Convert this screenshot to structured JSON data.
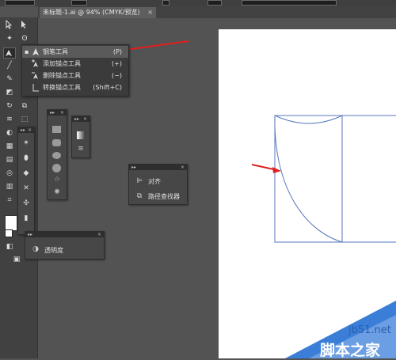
{
  "document_tab": {
    "title": "未标题-1.ai @ 94% (CMYK/预览)",
    "close": "×"
  },
  "tool_flyout": {
    "items": [
      {
        "label": "钢笔工具",
        "shortcut": "(P)",
        "selected": true,
        "icon": "pen-icon"
      },
      {
        "label": "添加锚点工具",
        "shortcut": "(+)",
        "selected": false,
        "icon": "add-anchor-icon"
      },
      {
        "label": "删除锚点工具",
        "shortcut": "(−)",
        "selected": false,
        "icon": "delete-anchor-icon"
      },
      {
        "label": "转换锚点工具",
        "shortcut": "(Shift+C)",
        "selected": false,
        "icon": "convert-anchor-icon"
      }
    ]
  },
  "align_panel": {
    "items": [
      {
        "label": "对齐",
        "icon": "align-icon"
      },
      {
        "label": "路径查找器",
        "icon": "pathfinder-icon"
      }
    ]
  },
  "transparency_panel": {
    "label": "透明度",
    "icon": "transparency-icon"
  },
  "panel_header": {
    "left": "▸▸",
    "right": "×"
  },
  "watermark": {
    "site": "jb51.net",
    "name": "脚本之家"
  },
  "colors": {
    "accent_red": "#e02020",
    "path_blue": "#5577bb",
    "canvas": "#ffffff",
    "ui_bg": "#535353"
  }
}
